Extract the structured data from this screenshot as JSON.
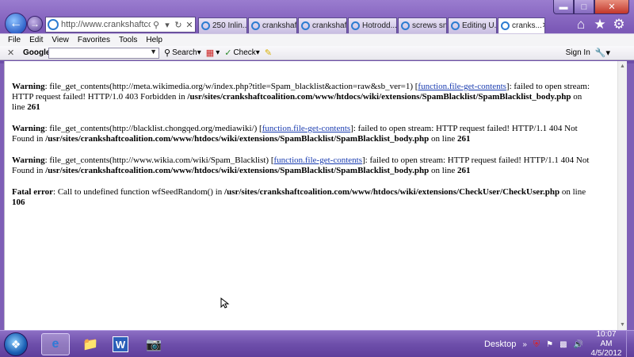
{
  "address": {
    "url": "http://www.crankshaftcoali..."
  },
  "tabs": [
    {
      "label": "250 Inlin..."
    },
    {
      "label": "crankshaf..."
    },
    {
      "label": "crankshaf..."
    },
    {
      "label": "Hotrodd..."
    },
    {
      "label": "screws sn..."
    },
    {
      "label": "Editing U..."
    },
    {
      "label": "cranks..."
    }
  ],
  "menu": [
    "File",
    "Edit",
    "View",
    "Favorites",
    "Tools",
    "Help"
  ],
  "toolbar": {
    "google": "Google",
    "search_label": "Search",
    "check_label": "Check",
    "signin_label": "Sign In"
  },
  "messages": [
    {
      "label": "Warning",
      "pre": ": file_get_contents(http://meta.wikimedia.org/w/index.php?title=Spam_blacklist&action=raw&sb_ver=1) [",
      "link": "function.file-get-contents",
      "post": "]: failed to open stream: HTTP request failed! HTTP/1.0 403 Forbidden in ",
      "path": "/usr/sites/crankshaftcoalition.com/www/htdocs/wiki/extensions/SpamBlacklist/SpamBlacklist_body.php",
      "on_line": " on line ",
      "line": "261"
    },
    {
      "label": "Warning",
      "pre": ": file_get_contents(http://blacklist.chongqed.org/mediawiki/) [",
      "link": "function.file-get-contents",
      "post": "]: failed to open stream: HTTP request failed! HTTP/1.1 404 Not Found in ",
      "path": "/usr/sites/crankshaftcoalition.com/www/htdocs/wiki/extensions/SpamBlacklist/SpamBlacklist_body.php",
      "on_line": " on line ",
      "line": "261"
    },
    {
      "label": "Warning",
      "pre": ": file_get_contents(http://www.wikia.com/wiki/Spam_Blacklist) [",
      "link": "function.file-get-contents",
      "post": "]: failed to open stream: HTTP request failed! HTTP/1.1 404 Not Found in ",
      "path": "/usr/sites/crankshaftcoalition.com/www/htdocs/wiki/extensions/SpamBlacklist/SpamBlacklist_body.php",
      "on_line": " on line ",
      "line": "261"
    }
  ],
  "fatal": {
    "label": "Fatal error",
    "pre": ": Call to undefined function wfSeedRandom() in ",
    "path": "/usr/sites/crankshaftcoalition.com/www/htdocs/wiki/extensions/CheckUser/CheckUser.php",
    "on_line": " on line ",
    "line": "106"
  },
  "taskbar": {
    "desktop_label": "Desktop",
    "time": "10:07 AM",
    "date": "4/5/2012"
  },
  "colors": {
    "frame": "#7e5fb6",
    "link": "#1a3cb0"
  }
}
